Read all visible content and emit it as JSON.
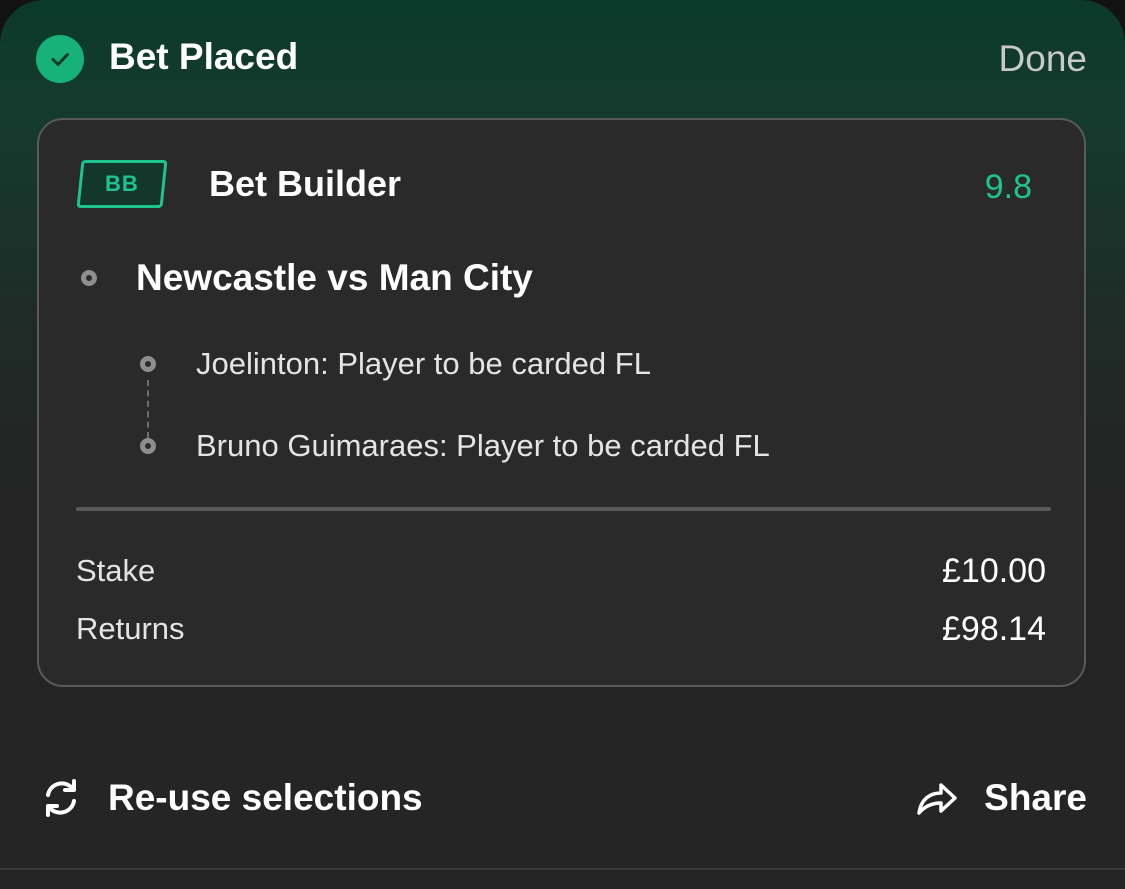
{
  "header": {
    "title": "Bet Placed",
    "done_label": "Done"
  },
  "bet": {
    "badge": "BB",
    "type": "Bet Builder",
    "odds": "9.8",
    "event": "Newcastle vs Man City",
    "selections": [
      "Joelinton: Player to be carded FL",
      "Bruno Guimaraes: Player to be carded FL"
    ],
    "stake_label": "Stake",
    "stake_value": "£10.00",
    "returns_label": "Returns",
    "returns_value": "£98.14"
  },
  "actions": {
    "reuse_label": "Re-use selections",
    "share_label": "Share"
  },
  "colors": {
    "accent": "#1fc390",
    "check": "#17b27a",
    "card_border": "#5a5a5a",
    "muted_text": "#c9c9c9"
  },
  "icons": [
    "check-icon",
    "refresh-icon",
    "share-arrow-icon"
  ]
}
